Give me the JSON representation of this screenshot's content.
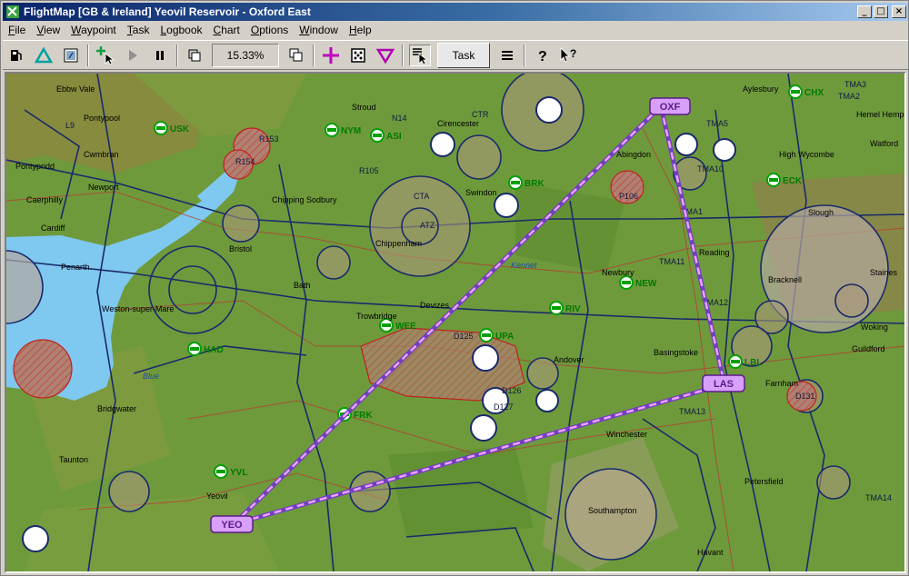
{
  "window": {
    "title": "FlightMap  [GB & Ireland]  Yeovil Reservoir - Oxford East",
    "minimize": "_",
    "maximize": "□",
    "close": "×"
  },
  "menu": [
    "File",
    "View",
    "Waypoint",
    "Task",
    "Logbook",
    "Chart",
    "Options",
    "Window",
    "Help"
  ],
  "toolbar": {
    "zoom": "15.33%",
    "task_label": "Task"
  },
  "colors": {
    "route_line": "#a070e0",
    "waypoint_box": "#d8a0f8",
    "airspace": "#1a2a6a",
    "sea": "#7fc8f0",
    "land": "#6a9a3a"
  },
  "map": {
    "waypoints": [
      "OXF",
      "LAS",
      "YEO"
    ],
    "airfields": [
      "USK",
      "NYM",
      "ASI",
      "CHX",
      "ECK",
      "WEE",
      "RIV",
      "NEW",
      "UPA",
      "HAD",
      "FRK",
      "YVL",
      "LBL",
      "BRK"
    ],
    "places": [
      "Ebbw Vale",
      "Pontypool",
      "Cwmbran",
      "Pontypridd",
      "Newport",
      "Caerphilly",
      "Cardiff",
      "Penarth",
      "Stroud",
      "Cirencester",
      "Chipping Sodbury",
      "Swindon",
      "Bristol",
      "Chippenham",
      "Bath",
      "Devizes",
      "Trowbridge",
      "Abingdon",
      "Newbury",
      "Reading",
      "Bracknell",
      "Slough",
      "Staines",
      "High Wycombe",
      "Aylesbury",
      "Hemel Hempstead",
      "Watford",
      "Woking",
      "Guildford",
      "Farnham",
      "Basingstoke",
      "Andover",
      "Winchester",
      "Southampton",
      "Petersfield",
      "Havant",
      "Taunton",
      "Bridgwater",
      "Yeovil",
      "Weston-super-Mare"
    ],
    "airspace_labels": [
      "CTR",
      "ATZ",
      "CTA",
      "TMA1",
      "TMA2",
      "TMA3",
      "TMA5",
      "TMA10",
      "TMA11",
      "TMA12",
      "TMA13",
      "TMA14",
      "D125",
      "D126",
      "D127",
      "D131",
      "P106",
      "R105",
      "R153",
      "R154",
      "L9",
      "N14"
    ],
    "river": "Kennet",
    "water": "Blue"
  }
}
